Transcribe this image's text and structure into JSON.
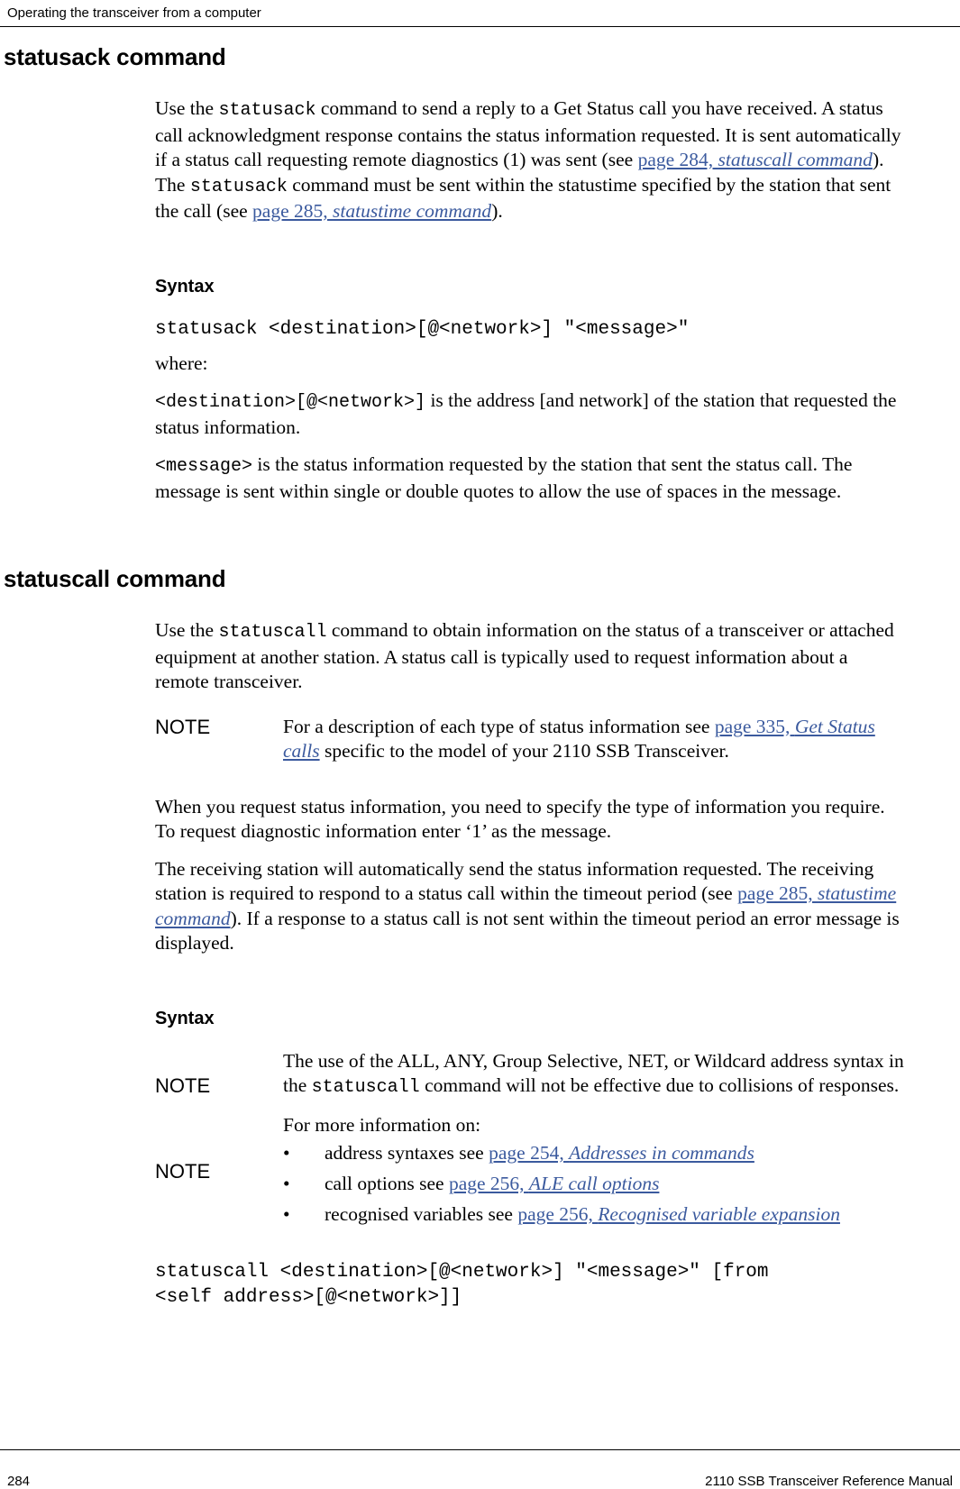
{
  "header": {
    "title": "Operating the transceiver from a computer"
  },
  "footer": {
    "page_number": "284",
    "manual_title": "2110 SSB Transceiver Reference Manual"
  },
  "sections": [
    {
      "heading": "statusack command",
      "intro_parts": [
        "Use the ",
        "statusack",
        " command to send a reply to a Get Status call you have received. A status call acknowledgment response contains the status information requested. It is sent automatically if a status call requesting remote diagnostics (1) was sent (see ",
        "page 284, ",
        "statuscall command",
        "). The ",
        "statusack",
        " command must be sent within the statustime specified by the station that sent the call (see ",
        "page 285, ",
        "statustime command",
        ")."
      ],
      "syntax_label": "Syntax",
      "syntax_code": "statusack <destination>[@<network>] \"<message>\"",
      "where_label": "where:",
      "param1_code": "<destination>[@<network>]",
      "param1_text": " is the address [and network] of the station that requested the status information.",
      "param2_code": "<message>",
      "param2_text": " is the status information requested by the station that sent the status call. The message is sent within single or double quotes to allow the use of spaces in the message."
    },
    {
      "heading": "statuscall command",
      "intro_parts": [
        "Use the ",
        "statuscall",
        " command to obtain information on the status of a transceiver or attached equipment at another station. A status call is typically used to request information about a remote transceiver."
      ],
      "note1_label": "NOTE",
      "note1_parts": [
        "For a description of each type of status information see ",
        "page 335, ",
        "Get Status calls",
        " specific to the model of your 2110 SSB Transceiver."
      ],
      "para2": "When you request status information, you need to specify the type of information you require. To request diagnostic information enter ‘1’ as the message.",
      "para3_parts": [
        "The receiving station will automatically send the status information requested. The receiving station is required to respond to a status call within the timeout period (see ",
        "page 285, ",
        "statustime command",
        "). If a response to a status call is not sent within the timeout period an error message is displayed."
      ],
      "syntax_label": "Syntax",
      "note2_label": "NOTE",
      "note2_parts": [
        "The use of the ALL, ANY, Group Selective, NET, or Wildcard address syntax in the ",
        "statuscall",
        " command will not be effective due to collisions of responses."
      ],
      "note3_label": "NOTE",
      "note3_intro": "For more information on:",
      "note3_bullets": [
        {
          "bullet": "•",
          "text": "address syntaxes see ",
          "link": "page 254, ",
          "linkit": "Addresses in commands"
        },
        {
          "bullet": "•",
          "text": "call options see ",
          "link": "page 256, ",
          "linkit": "ALE call options"
        },
        {
          "bullet": "•",
          "text": "recognised variables see ",
          "link": "page 256, ",
          "linkit": "Recognised variable expansion"
        }
      ],
      "syntax_code_line1": "statuscall <destination>[@<network>] \"<message>\" [from",
      "syntax_code_line2": "<self address>[@<network>]]"
    }
  ]
}
